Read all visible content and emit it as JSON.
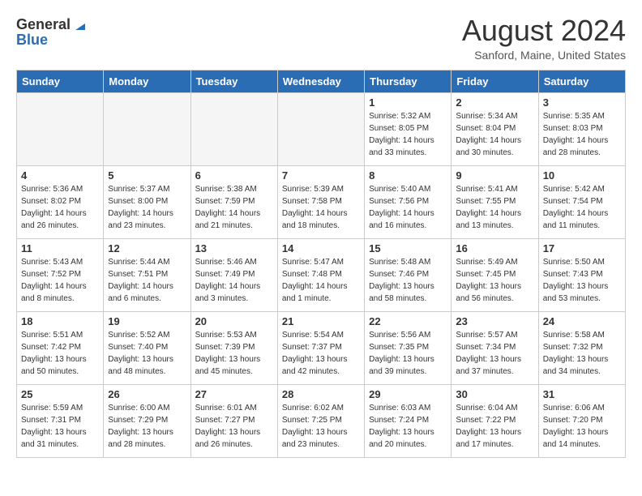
{
  "header": {
    "logo_general": "General",
    "logo_blue": "Blue",
    "month_title": "August 2024",
    "location": "Sanford, Maine, United States"
  },
  "days_of_week": [
    "Sunday",
    "Monday",
    "Tuesday",
    "Wednesday",
    "Thursday",
    "Friday",
    "Saturday"
  ],
  "weeks": [
    [
      {
        "num": "",
        "info": ""
      },
      {
        "num": "",
        "info": ""
      },
      {
        "num": "",
        "info": ""
      },
      {
        "num": "",
        "info": ""
      },
      {
        "num": "1",
        "info": "Sunrise: 5:32 AM\nSunset: 8:05 PM\nDaylight: 14 hours\nand 33 minutes."
      },
      {
        "num": "2",
        "info": "Sunrise: 5:34 AM\nSunset: 8:04 PM\nDaylight: 14 hours\nand 30 minutes."
      },
      {
        "num": "3",
        "info": "Sunrise: 5:35 AM\nSunset: 8:03 PM\nDaylight: 14 hours\nand 28 minutes."
      }
    ],
    [
      {
        "num": "4",
        "info": "Sunrise: 5:36 AM\nSunset: 8:02 PM\nDaylight: 14 hours\nand 26 minutes."
      },
      {
        "num": "5",
        "info": "Sunrise: 5:37 AM\nSunset: 8:00 PM\nDaylight: 14 hours\nand 23 minutes."
      },
      {
        "num": "6",
        "info": "Sunrise: 5:38 AM\nSunset: 7:59 PM\nDaylight: 14 hours\nand 21 minutes."
      },
      {
        "num": "7",
        "info": "Sunrise: 5:39 AM\nSunset: 7:58 PM\nDaylight: 14 hours\nand 18 minutes."
      },
      {
        "num": "8",
        "info": "Sunrise: 5:40 AM\nSunset: 7:56 PM\nDaylight: 14 hours\nand 16 minutes."
      },
      {
        "num": "9",
        "info": "Sunrise: 5:41 AM\nSunset: 7:55 PM\nDaylight: 14 hours\nand 13 minutes."
      },
      {
        "num": "10",
        "info": "Sunrise: 5:42 AM\nSunset: 7:54 PM\nDaylight: 14 hours\nand 11 minutes."
      }
    ],
    [
      {
        "num": "11",
        "info": "Sunrise: 5:43 AM\nSunset: 7:52 PM\nDaylight: 14 hours\nand 8 minutes."
      },
      {
        "num": "12",
        "info": "Sunrise: 5:44 AM\nSunset: 7:51 PM\nDaylight: 14 hours\nand 6 minutes."
      },
      {
        "num": "13",
        "info": "Sunrise: 5:46 AM\nSunset: 7:49 PM\nDaylight: 14 hours\nand 3 minutes."
      },
      {
        "num": "14",
        "info": "Sunrise: 5:47 AM\nSunset: 7:48 PM\nDaylight: 14 hours\nand 1 minute."
      },
      {
        "num": "15",
        "info": "Sunrise: 5:48 AM\nSunset: 7:46 PM\nDaylight: 13 hours\nand 58 minutes."
      },
      {
        "num": "16",
        "info": "Sunrise: 5:49 AM\nSunset: 7:45 PM\nDaylight: 13 hours\nand 56 minutes."
      },
      {
        "num": "17",
        "info": "Sunrise: 5:50 AM\nSunset: 7:43 PM\nDaylight: 13 hours\nand 53 minutes."
      }
    ],
    [
      {
        "num": "18",
        "info": "Sunrise: 5:51 AM\nSunset: 7:42 PM\nDaylight: 13 hours\nand 50 minutes."
      },
      {
        "num": "19",
        "info": "Sunrise: 5:52 AM\nSunset: 7:40 PM\nDaylight: 13 hours\nand 48 minutes."
      },
      {
        "num": "20",
        "info": "Sunrise: 5:53 AM\nSunset: 7:39 PM\nDaylight: 13 hours\nand 45 minutes."
      },
      {
        "num": "21",
        "info": "Sunrise: 5:54 AM\nSunset: 7:37 PM\nDaylight: 13 hours\nand 42 minutes."
      },
      {
        "num": "22",
        "info": "Sunrise: 5:56 AM\nSunset: 7:35 PM\nDaylight: 13 hours\nand 39 minutes."
      },
      {
        "num": "23",
        "info": "Sunrise: 5:57 AM\nSunset: 7:34 PM\nDaylight: 13 hours\nand 37 minutes."
      },
      {
        "num": "24",
        "info": "Sunrise: 5:58 AM\nSunset: 7:32 PM\nDaylight: 13 hours\nand 34 minutes."
      }
    ],
    [
      {
        "num": "25",
        "info": "Sunrise: 5:59 AM\nSunset: 7:31 PM\nDaylight: 13 hours\nand 31 minutes."
      },
      {
        "num": "26",
        "info": "Sunrise: 6:00 AM\nSunset: 7:29 PM\nDaylight: 13 hours\nand 28 minutes."
      },
      {
        "num": "27",
        "info": "Sunrise: 6:01 AM\nSunset: 7:27 PM\nDaylight: 13 hours\nand 26 minutes."
      },
      {
        "num": "28",
        "info": "Sunrise: 6:02 AM\nSunset: 7:25 PM\nDaylight: 13 hours\nand 23 minutes."
      },
      {
        "num": "29",
        "info": "Sunrise: 6:03 AM\nSunset: 7:24 PM\nDaylight: 13 hours\nand 20 minutes."
      },
      {
        "num": "30",
        "info": "Sunrise: 6:04 AM\nSunset: 7:22 PM\nDaylight: 13 hours\nand 17 minutes."
      },
      {
        "num": "31",
        "info": "Sunrise: 6:06 AM\nSunset: 7:20 PM\nDaylight: 13 hours\nand 14 minutes."
      }
    ]
  ]
}
